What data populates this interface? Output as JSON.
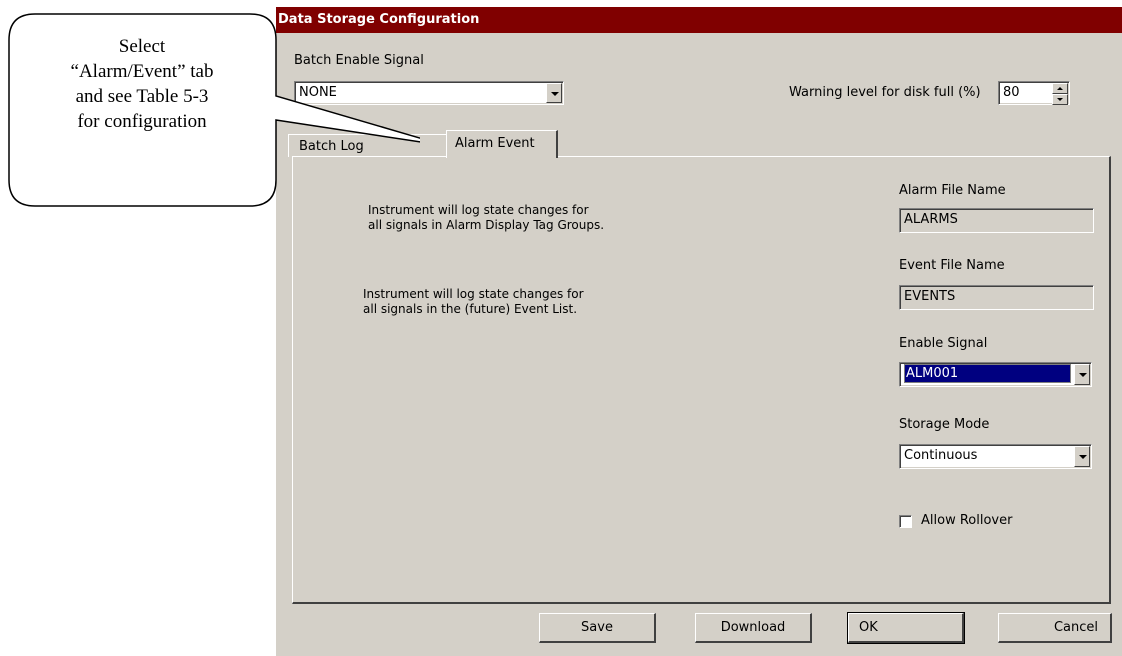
{
  "window": {
    "title": "Data Storage Configuration"
  },
  "batch": {
    "label": "Batch Enable Signal",
    "value": "NONE"
  },
  "warning": {
    "label": "Warning level for disk full (%)",
    "value": "80"
  },
  "tabs": [
    {
      "label": "Batch Log"
    },
    {
      "label": "Alarm Event"
    }
  ],
  "panel": {
    "alarm_note_line1": "Instrument will log state changes for",
    "alarm_note_line2": "all signals in Alarm Display Tag Groups.",
    "event_note_line1": "Instrument will log state changes for",
    "event_note_line2": "all signals in the (future) Event  List.",
    "alarm_file": {
      "label": "Alarm File Name",
      "value": "ALARMS"
    },
    "event_file": {
      "label": "Event File Name",
      "value": "EVENTS"
    },
    "enable_signal": {
      "label": "Enable Signal",
      "value": "ALM001"
    },
    "storage_mode": {
      "label": "Storage Mode",
      "value": "Continuous"
    },
    "allow_rollover": {
      "label": "Allow Rollover",
      "checked": false
    }
  },
  "buttons": {
    "save": "Save",
    "download": "Download",
    "ok": "OK",
    "cancel": "Cancel"
  },
  "callout": {
    "line1": "Select",
    "line2": "“Alarm/Event” tab",
    "line3": "and see Table 5-3",
    "line4": "for configuration"
  },
  "colors": {
    "titlebar": "#800000",
    "face": "#d4d0c8",
    "selection": "#000080"
  }
}
